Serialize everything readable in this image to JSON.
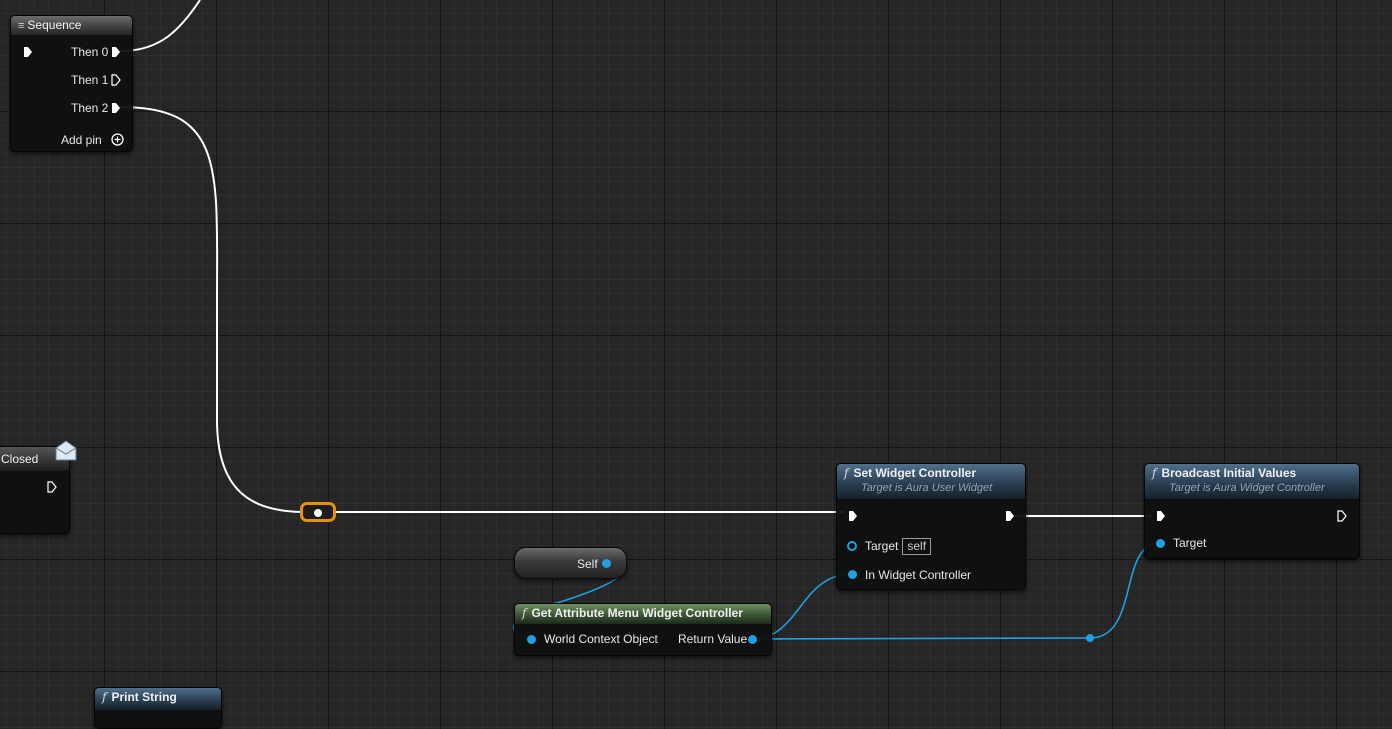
{
  "nodes": {
    "sequence": {
      "title": "Sequence",
      "pins": [
        "Then 0",
        "Then 1",
        "Then 2"
      ],
      "add_pin": "Add pin"
    },
    "closed_event": {
      "title": "Closed"
    },
    "self_node": {
      "label": "Self"
    },
    "get_attr_menu": {
      "title": "Get Attribute Menu Widget Controller",
      "input": "World Context Object",
      "output": "Return Value"
    },
    "set_widget_controller": {
      "title": "Set Widget Controller",
      "subtitle": "Target is Aura User Widget",
      "target_label": "Target",
      "target_default": "self",
      "in_widget_label": "In Widget Controller"
    },
    "broadcast": {
      "title": "Broadcast Initial Values",
      "subtitle": "Target is Aura Widget Controller",
      "target_label": "Target"
    },
    "print_string": {
      "title": "Print String"
    }
  },
  "colors": {
    "exec_wire": "#ffffff",
    "object_pin": "#1fa0e0",
    "reroute_selected": "#e8900c",
    "function_header": "#3d5a78",
    "pure_function_header": "#4d6b44"
  },
  "icons": {
    "sequence": "sequence-icon",
    "function": "function-icon",
    "event": "envelope-icon"
  }
}
